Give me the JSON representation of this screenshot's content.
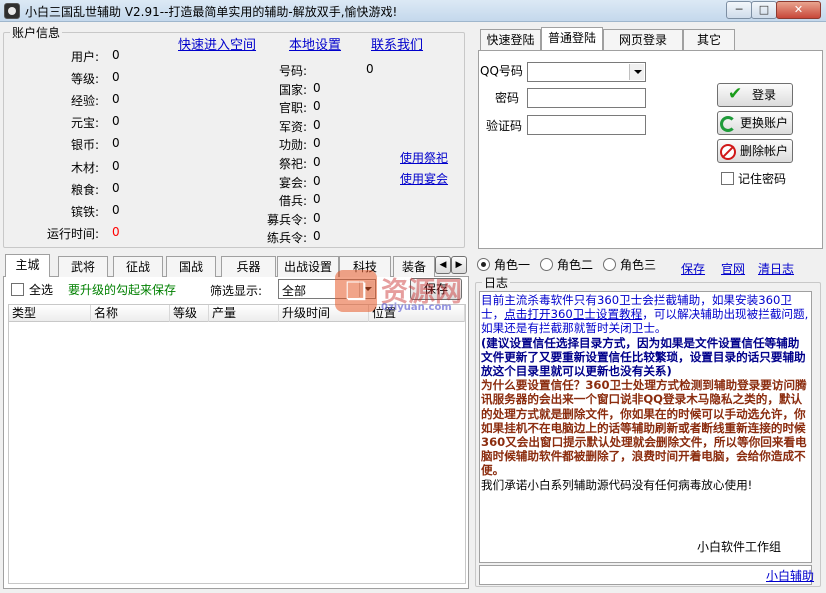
{
  "window": {
    "title": "小白三国乱世辅助 V2.91--打造最简单实用的辅助-解放双手,愉快游戏!",
    "minimize_glyph": "─",
    "maximize_glyph": "□",
    "close_glyph": "✕"
  },
  "account": {
    "group_title": "账户信息",
    "links": [
      "快速进入空间",
      "本地设置",
      "联系我们"
    ],
    "left_rows": [
      {
        "label": "用户:",
        "value": "0"
      },
      {
        "label": "等级:",
        "value": "0"
      },
      {
        "label": "经验:",
        "value": "0"
      },
      {
        "label": "元宝:",
        "value": "0"
      },
      {
        "label": "银币:",
        "value": "0"
      },
      {
        "label": "木材:",
        "value": "0"
      },
      {
        "label": "粮食:",
        "value": "0"
      },
      {
        "label": "镔铁:",
        "value": "0"
      },
      {
        "label": "运行时间:",
        "value": "0",
        "color": "#ff0000"
      }
    ],
    "right_rows": [
      {
        "label": "号码:",
        "value": "0"
      },
      {
        "label": "国家:",
        "value": "0"
      },
      {
        "label": "官职:",
        "value": "0"
      },
      {
        "label": "军资:",
        "value": "0"
      },
      {
        "label": "功勋:",
        "value": "0"
      },
      {
        "label": "祭祀:",
        "value": "0"
      },
      {
        "label": "宴会:",
        "value": "0"
      },
      {
        "label": "借兵:",
        "value": "0"
      },
      {
        "label": "募兵令:",
        "value": "0"
      },
      {
        "label": "练兵令:",
        "value": "0"
      }
    ],
    "action_links": [
      "使用祭祀",
      "使用宴会"
    ]
  },
  "login": {
    "tabs": [
      "快速登陆",
      "普通登陆",
      "网页登录",
      "其它"
    ],
    "active_tab": 1,
    "qq_label": "QQ号码",
    "password_label": "密码",
    "captcha_label": "验证码",
    "login_button": "登录",
    "switch_button": "更换账户",
    "delete_button": "删除帐户",
    "remember_label": "记住密码"
  },
  "modules": {
    "tabs": [
      "主城",
      "武将",
      "征战",
      "国战",
      "兵器",
      "出战设置",
      "科技",
      "装备"
    ],
    "active_tab": 0,
    "select_all_label": "全选",
    "hint": "要升级的勾起来保存",
    "filter_label": "筛选显示:",
    "filter_value": "全部",
    "save_button": "保存",
    "columns": [
      "类型",
      "名称",
      "等级",
      "产量",
      "升级时间",
      "位置"
    ],
    "scroll_left": "◀",
    "scroll_right": "▶"
  },
  "log": {
    "roles": [
      "角色一",
      "角色二",
      "角色三"
    ],
    "selected_role": 0,
    "links": [
      "保存",
      "官网",
      "清日志"
    ],
    "group_title": "日志",
    "line1_a": "目前主流杀毒软件只有360卫士会拦截辅助，如果安装360卫士，",
    "line1_link": "点击打开360卫士设置教程",
    "line1_b": "，可以解决辅助出现被拦截问题,如果还是有拦截那就暂时关闭卫士。",
    "line2": "(建议设置信任选择目录方式，因为如果是文件设置信任等辅助文件更新了又要重新设置信任比较繁琐，设置目录的话只要辅助放这个目录里就可以更新也没有关系)",
    "line3": "为什么要设置信任？360卫士处理方式检测到辅助登录要访问腾讯服务器的会出来一个窗口说非QQ登录木马隐私之类的，默认的处理方式就是删除文件，你如果在的时候可以手动选允许，你如果挂机不在电脑边上的话等辅助刷新或者断线重新连接的时候360又会出窗口提示默认处理就会删除文件，所以等你回来看电脑时候辅助软件都被删除了，浪费时间开着电脑，会给你造成不便。",
    "line4": "我们承诺小白系列辅助源代码没有任何病毒放心使用!",
    "signature": "小白软件工作组",
    "footer_link": "小白辅助",
    "colors": {
      "blue": "#0000cc",
      "navy": "#00008b",
      "brown": "#8b2c0e"
    }
  },
  "watermark": {
    "text": "资源网",
    "url": "0ziyuan.com"
  }
}
